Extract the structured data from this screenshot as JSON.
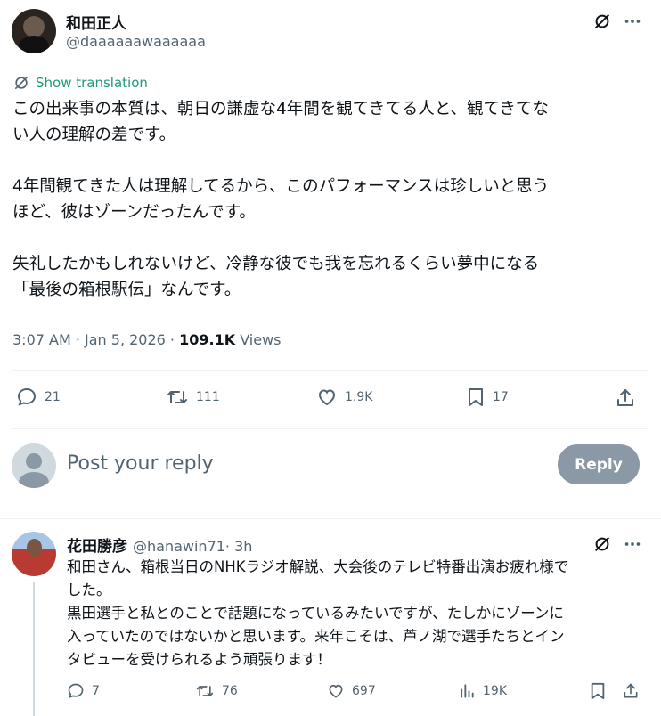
{
  "post": {
    "author_name": "和田正人",
    "author_handle": "@daaaaaawaaaaaa",
    "translate_label": "Show translation",
    "paragraphs": [
      [
        "この出来事の本質は、朝日の謙虚な4年間を観てきてる人と、観てきてな",
        "い人の理解の差です。"
      ],
      [
        "4年間観てきた人は理解してるから、このパフォーマンスは珍しいと思う",
        "ほど、彼はゾーンだったんです。"
      ],
      [
        "失礼したかもしれないけど、冷静な彼でも我を忘れるくらい夢中になる",
        "「最後の箱根駅伝」なんです。"
      ]
    ],
    "timestamp": "3:07 AM · Jan 5, 2026 · ",
    "views_count": "109.1K",
    "views_label": " Views",
    "actions": {
      "replies": "21",
      "reposts": "111",
      "likes": "1.9K",
      "bookmarks": "17"
    }
  },
  "composer": {
    "placeholder": "Post your reply",
    "reply_button": "Reply"
  },
  "reply": {
    "author_name": "花田勝彦",
    "author_handle": "@hanawin71",
    "time": " · 3h",
    "lines": [
      "和田さん、箱根当日のNHKラジオ解説、大会後のテレビ特番出演お疲れ様で",
      "した。",
      "黒田選手と私とのことで話題になっているみたいですが、たしかにゾーンに",
      "入っていたのではないかと思います。来年こそは、芦ノ湖で選手たちとイン",
      "タビューを受けられるよう頑張ります！"
    ],
    "actions": {
      "replies": "7",
      "reposts": "76",
      "likes": "697",
      "views": "19K"
    }
  },
  "icons": {
    "grok": "grok-icon",
    "more": "more-icon",
    "translate": "translate-icon",
    "reply": "reply-icon",
    "repost": "repost-icon",
    "like": "heart-icon",
    "bookmark": "bookmark-icon",
    "share": "share-icon",
    "views": "views-icon"
  },
  "colors": {
    "text": "#0f1419",
    "secondary": "#536471",
    "reply_button": "#8b98a5",
    "translate_green": "#1d9b7a"
  }
}
